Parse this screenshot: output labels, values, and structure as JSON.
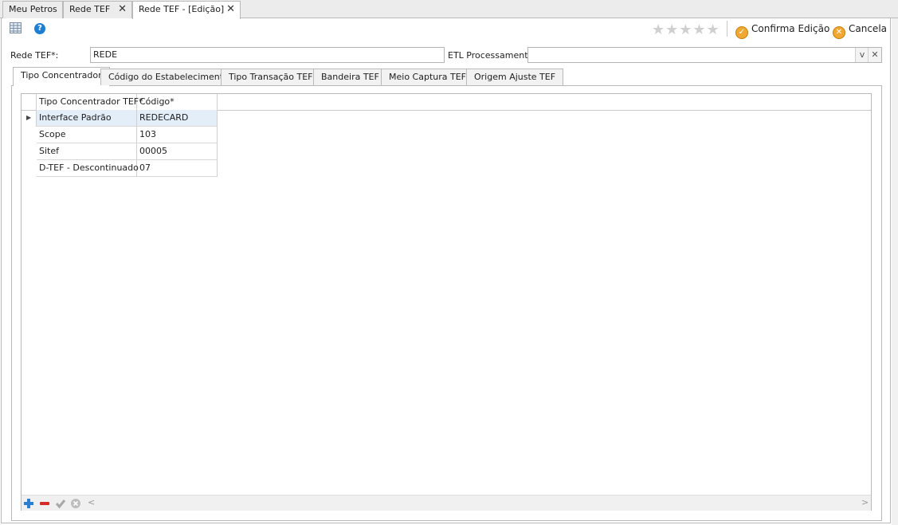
{
  "doc_tabs": [
    {
      "label": "Meu Petros",
      "closable": false
    },
    {
      "label": "Rede TEF",
      "closable": true
    },
    {
      "label": "Rede TEF - [Edição]",
      "closable": true
    }
  ],
  "close_glyph": "✕",
  "toolbar": {
    "rating_stars": "★★★★★",
    "confirm_label": "Confirma Edição",
    "cancel_label": "Cancela",
    "confirm_glyph": "✓",
    "cancel_glyph": "✕",
    "help_glyph": "?"
  },
  "form": {
    "rede_label": "Rede TEF*:",
    "rede_value": "REDE",
    "etl_label": "ETL Processamento:",
    "etl_value": "",
    "dropdown_glyph": "v",
    "clear_glyph": "✕"
  },
  "inner_tabs": [
    "Tipo Concentrador",
    "Código do Estabelecimento",
    "Tipo Transação TEF",
    "Bandeira TEF",
    "Meio Captura TEF",
    "Origem Ajuste TEF"
  ],
  "grid": {
    "columns": [
      "Tipo Concentrador TEF*",
      "Código*"
    ],
    "rows": [
      [
        "Interface Padrão",
        "REDECARD"
      ],
      [
        "Scope",
        "103"
      ],
      [
        "Sitef",
        "00005"
      ],
      [
        "D-TEF - Descontinuado",
        "07"
      ]
    ],
    "row_indicator": "▶",
    "scroll_left": "<",
    "scroll_right": ">"
  },
  "colors": {
    "accent": "#f0a830",
    "selected_row": "#e3eef9",
    "help": "#1e7fd0"
  }
}
